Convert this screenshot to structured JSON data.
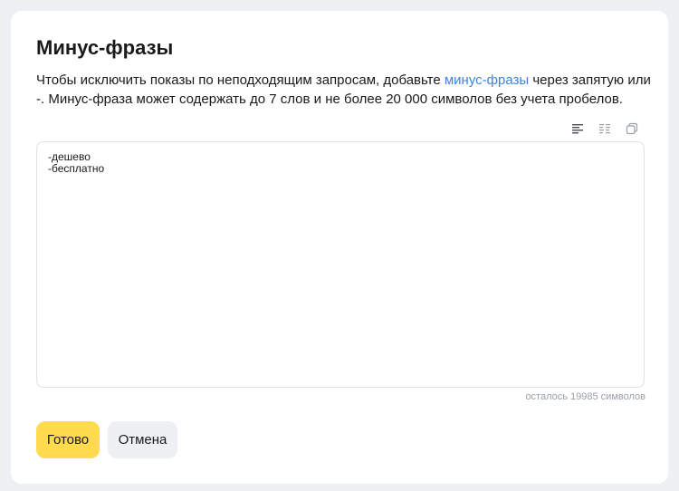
{
  "title": "Минус-фразы",
  "description": {
    "text_before": "Чтобы исключить показы по неподходящим запросам, добавьте ",
    "link_text": "минус-фразы",
    "text_after": " через запятую или -. Минус-фраза может содержать до 7 слов и не более 20 000 символов без учета пробелов."
  },
  "toolbar": {
    "icons": [
      "list-view-icon",
      "column-view-icon",
      "copy-icon"
    ]
  },
  "editor": {
    "lines": [
      "-дешево",
      "-бесплатно"
    ]
  },
  "counter_text": "осталось 19985 символов",
  "buttons": {
    "done_label": "Готово",
    "cancel_label": "Отмена"
  },
  "colors": {
    "accent_yellow": "#ffdb4d",
    "link_blue": "#3e82e0",
    "background": "#eef0f4"
  }
}
